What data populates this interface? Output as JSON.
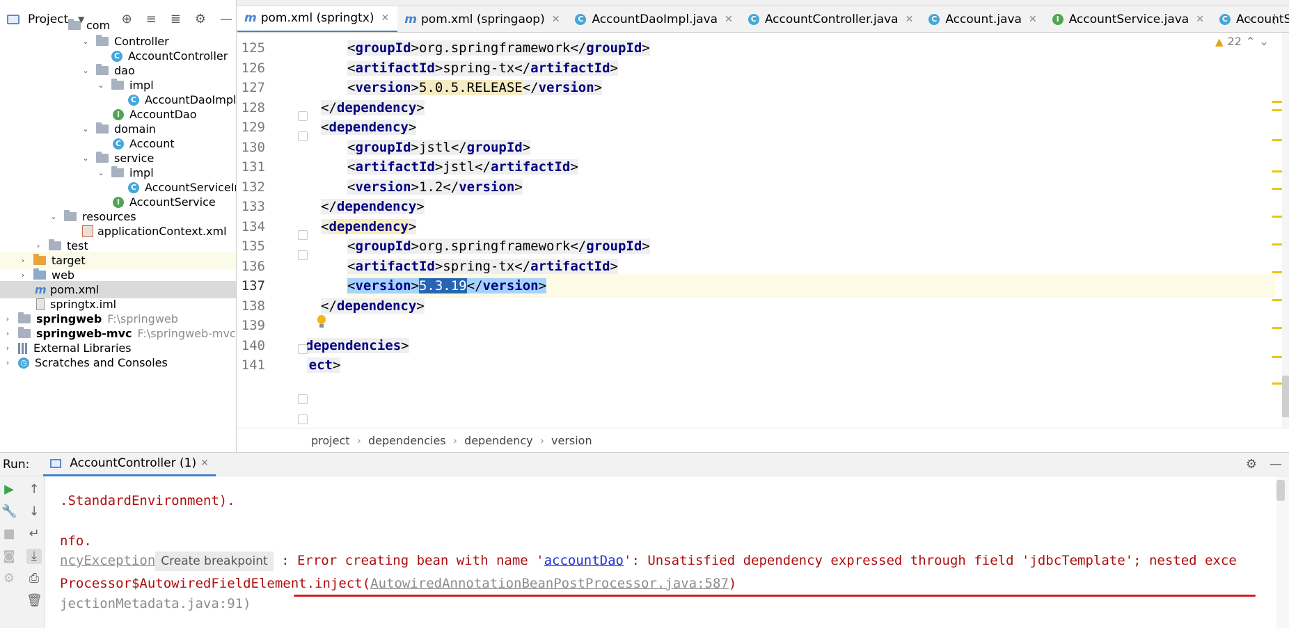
{
  "project_panel": {
    "title": "Project",
    "tree": [
      {
        "label": "com",
        "type": "folder"
      },
      {
        "label": "Controller",
        "type": "folder"
      },
      {
        "label": "AccountController",
        "type": "class"
      },
      {
        "label": "dao",
        "type": "folder"
      },
      {
        "label": "impl",
        "type": "folder"
      },
      {
        "label": "AccountDaoImpl",
        "type": "class"
      },
      {
        "label": "AccountDao",
        "type": "interface"
      },
      {
        "label": "domain",
        "type": "folder"
      },
      {
        "label": "Account",
        "type": "class"
      },
      {
        "label": "service",
        "type": "folder"
      },
      {
        "label": "impl",
        "type": "folder"
      },
      {
        "label": "AccountServiceIm",
        "type": "class"
      },
      {
        "label": "AccountService",
        "type": "interface"
      },
      {
        "label": "resources",
        "type": "folder"
      },
      {
        "label": "applicationContext.xml",
        "type": "xml"
      },
      {
        "label": "test",
        "type": "folder"
      },
      {
        "label": "target",
        "type": "folder"
      },
      {
        "label": "web",
        "type": "folder"
      },
      {
        "label": "pom.xml",
        "type": "maven"
      },
      {
        "label": "springtx.iml",
        "type": "iml"
      },
      {
        "label": "springweb",
        "path": "F:\\springweb",
        "type": "module"
      },
      {
        "label": "springweb-mvc",
        "path": "F:\\springweb-mvc",
        "type": "module"
      },
      {
        "label": "External Libraries",
        "type": "libs"
      },
      {
        "label": "Scratches and Consoles",
        "type": "scratch"
      }
    ]
  },
  "editor": {
    "tabs": [
      {
        "label": "pom.xml (springtx)",
        "icon": "maven-icon"
      },
      {
        "label": "pom.xml (springaop)",
        "icon": "maven-icon"
      },
      {
        "label": "AccountDaoImpl.java",
        "icon": "class-icon"
      },
      {
        "label": "AccountController.java",
        "icon": "class-icon"
      },
      {
        "label": "Account.java",
        "icon": "class-icon"
      },
      {
        "label": "AccountService.java",
        "icon": "interface-icon"
      },
      {
        "label": "AccountServiceImpl.jav",
        "icon": "class-icon"
      }
    ],
    "warning_count": "22",
    "line_numbers": [
      "125",
      "126",
      "127",
      "128",
      "129",
      "130",
      "131",
      "132",
      "133",
      "134",
      "135",
      "136",
      "137",
      "138",
      "139",
      "140",
      "141"
    ],
    "lines": [
      {
        "indent": "        ",
        "tag": "groupId",
        "value": "org.springframework"
      },
      {
        "indent": "        ",
        "tag": "artifactId",
        "value": "spring-tx"
      },
      {
        "indent": "        ",
        "tag": "version",
        "value": "5.0.5.RELEASE"
      },
      {
        "indent": "    ",
        "close": "dependency"
      },
      {
        "indent": "    ",
        "open": "dependency"
      },
      {
        "indent": "        ",
        "tag": "groupId",
        "value": "jstl"
      },
      {
        "indent": "        ",
        "tag": "artifactId",
        "value": "jstl"
      },
      {
        "indent": "        ",
        "tag": "version",
        "value": "1.2"
      },
      {
        "indent": "    ",
        "close": "dependency"
      },
      {
        "indent": "    ",
        "open": "dependency"
      },
      {
        "indent": "        ",
        "tag": "groupId",
        "value": "org.springframework"
      },
      {
        "indent": "        ",
        "tag": "artifactId",
        "value": "spring-tx"
      },
      {
        "indent": "        ",
        "tag": "version",
        "value": "5.3.19"
      },
      {
        "indent": "    ",
        "close": "dependency"
      },
      {
        "indent": "",
        "blank": true
      },
      {
        "indent": "",
        "close": "dependencies"
      },
      {
        "indent": "",
        "close": "project"
      }
    ],
    "breadcrumb": [
      "project",
      "dependencies",
      "dependency",
      "version"
    ]
  },
  "run": {
    "label": "Run:",
    "tab": "AccountController (1)",
    "console": {
      "line1": ".StandardEnvironment).",
      "line2": "nfo.",
      "line3_prefix": "ncyException",
      "tooltip": "Create breakpoint",
      "line3_a": ": Error creating bean with name '",
      "line3_link": "accountDao",
      "line3_b": "': Unsatisfied dependency expressed through field 'jdbcTemplate'; nested exce",
      "line4_a": "Processor$AutowiredFieldElement.inject(",
      "line4_link": "AutowiredAnnotationBeanPostProcessor.java:587",
      "line4_b": ")",
      "line5": "jectionMetadata.java:91)"
    }
  },
  "colors": {
    "accent": "#4083c9",
    "error_text": "#b00e0e",
    "underline": "#d21c1c",
    "xml_tag": "#000080"
  }
}
